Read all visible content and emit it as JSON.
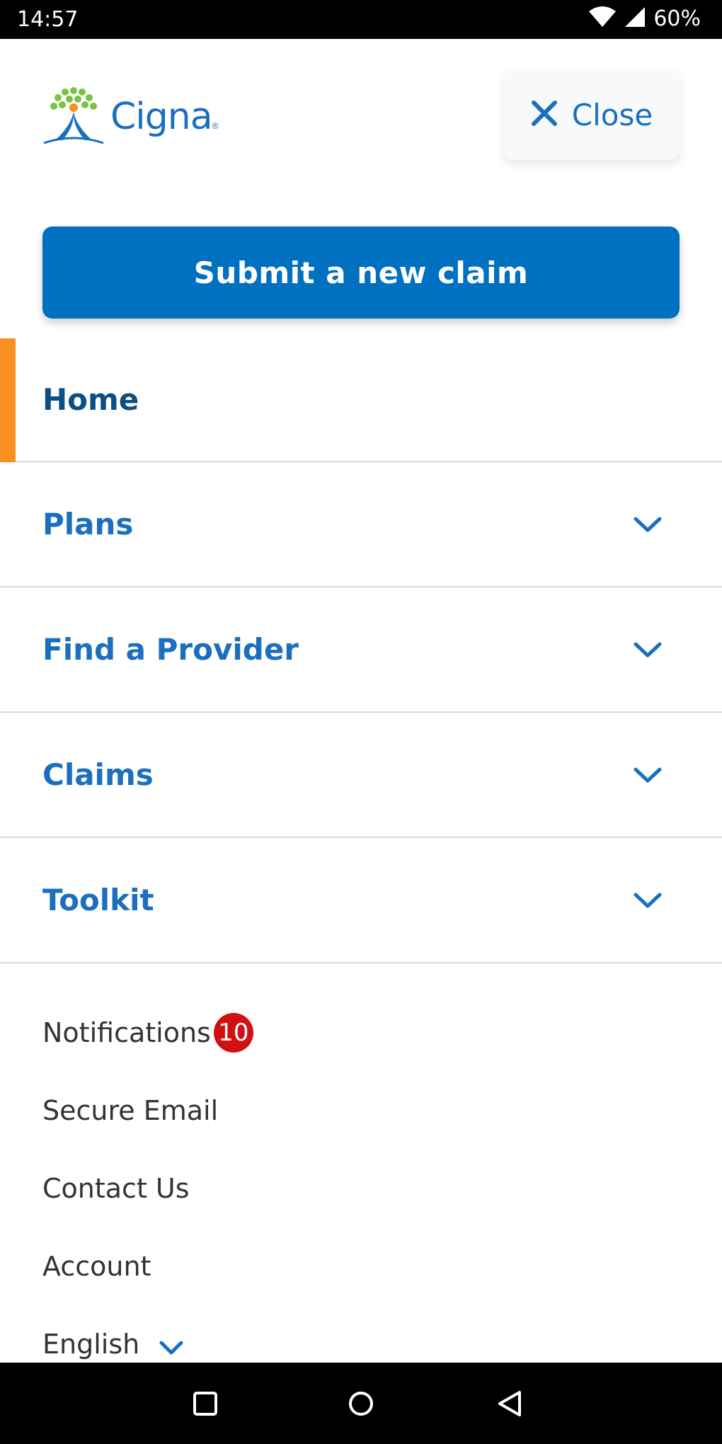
{
  "status_bar": {
    "time": "14:57",
    "battery": "60%"
  },
  "header": {
    "brand": "Cigna",
    "close_label": "Close"
  },
  "primary_action": {
    "label": "Submit a new claim"
  },
  "nav": {
    "items": [
      {
        "label": "Home",
        "active": true
      },
      {
        "label": "Plans"
      },
      {
        "label": "Find a Provider"
      },
      {
        "label": "Claims"
      },
      {
        "label": "Toolkit"
      }
    ]
  },
  "links": {
    "notifications": {
      "label": "Notifications",
      "count": "10"
    },
    "secure_email": "Secure Email",
    "contact_us": "Contact Us",
    "account": "Account",
    "language": "English"
  },
  "colors": {
    "accent": "#0070c0",
    "link": "#1a6fbe",
    "active_bar": "#f7901e",
    "badge": "#d20f12"
  },
  "icons": [
    "wifi-icon",
    "signal-icon",
    "close-icon",
    "chevron-down-icon",
    "recent-apps-icon",
    "home-icon",
    "back-icon"
  ]
}
